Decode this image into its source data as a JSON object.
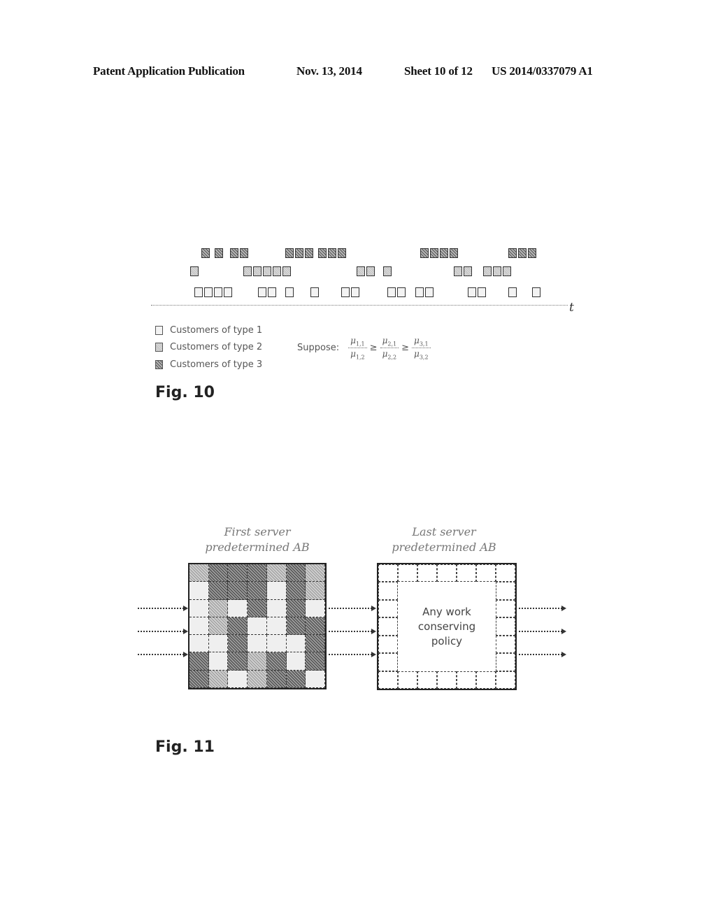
{
  "header": {
    "publication": "Patent Application Publication",
    "date": "Nov. 13, 2014",
    "sheet": "Sheet 10 of 12",
    "number": "US 2014/0337079 A1"
  },
  "fig10": {
    "label": "Fig. 10",
    "axis_label": "t",
    "timeline_rows": [
      {
        "row": "top",
        "type": 3,
        "blocks": [
          [
            288,
            1
          ],
          [
            307,
            1
          ],
          [
            329,
            2
          ],
          [
            408,
            3
          ],
          [
            455,
            3
          ],
          [
            601,
            4
          ],
          [
            727,
            3
          ]
        ]
      },
      {
        "row": "middle",
        "type": 2,
        "blocks": [
          [
            272,
            1
          ],
          [
            348,
            5
          ],
          [
            510,
            2
          ],
          [
            548,
            1
          ],
          [
            649,
            2
          ],
          [
            691,
            3
          ]
        ]
      },
      {
        "row": "bottom",
        "type": 1,
        "blocks": [
          [
            278,
            4
          ],
          [
            369,
            2
          ],
          [
            408,
            1
          ],
          [
            444,
            1
          ],
          [
            488,
            2
          ],
          [
            554,
            2
          ],
          [
            594,
            2
          ],
          [
            669,
            2
          ],
          [
            727,
            1
          ],
          [
            761,
            1
          ]
        ]
      }
    ],
    "legend": [
      {
        "label": "Customers of type 1",
        "type": 1
      },
      {
        "label": "Customers of type 2",
        "type": 2
      },
      {
        "label": "Customers of type 3",
        "type": 3
      }
    ],
    "suppose_label": "Suppose:",
    "fractions": [
      {
        "num": "μ",
        "num_sub": "1,1",
        "den": "μ",
        "den_sub": "1,2"
      },
      {
        "num": "μ",
        "num_sub": "2,1",
        "den": "μ",
        "den_sub": "2,2"
      },
      {
        "num": "μ",
        "num_sub": "3,1",
        "den": "μ",
        "den_sub": "3,2"
      }
    ],
    "relation": "≥"
  },
  "fig11": {
    "label": "Fig. 11",
    "first_server_title": [
      "First server",
      "predetermined AB"
    ],
    "last_server_title": [
      "Last server",
      "predetermined AB"
    ],
    "policy_text": [
      "Any work",
      "conserving",
      "policy"
    ],
    "grid_shades": [
      [
        2,
        3,
        3,
        3,
        2,
        3,
        2
      ],
      [
        1,
        3,
        3,
        3,
        1,
        3,
        2
      ],
      [
        1,
        2,
        1,
        3,
        1,
        3,
        1
      ],
      [
        1,
        2,
        3,
        1,
        1,
        3,
        3
      ],
      [
        1,
        1,
        3,
        1,
        1,
        1,
        3
      ],
      [
        3,
        1,
        3,
        2,
        3,
        1,
        3
      ],
      [
        3,
        2,
        1,
        2,
        3,
        3,
        1
      ]
    ]
  }
}
